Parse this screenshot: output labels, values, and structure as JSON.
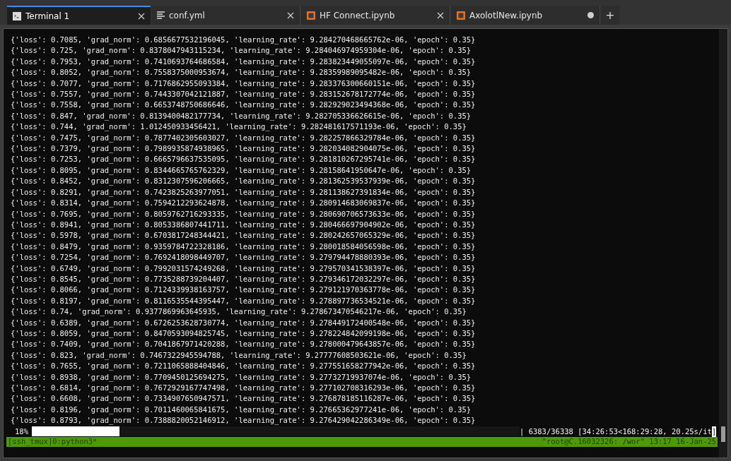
{
  "tabs": [
    {
      "label": "Terminal 1",
      "kind": "terminal",
      "selected": true,
      "modified": false
    },
    {
      "label": "conf.yml",
      "kind": "text",
      "selected": false,
      "modified": false
    },
    {
      "label": "HF Connect.ipynb",
      "kind": "notebook",
      "selected": false,
      "modified": false
    },
    {
      "label": "AxolotlNew.ipynb",
      "kind": "notebook",
      "selected": false,
      "modified": true
    }
  ],
  "new_tab": "+",
  "terminal": {
    "lines": [
      "{'loss': 0.7085, 'grad_norm': 0.6856677532196045, 'learning_rate': 9.284270468665762e-06, 'epoch': 0.35}",
      "{'loss': 0.725, 'grad_norm': 0.8378047943115234, 'learning_rate': 9.284046974959304e-06, 'epoch': 0.35}",
      "{'loss': 0.7953, 'grad_norm': 0.7410693764686584, 'learning_rate': 9.283823449055097e-06, 'epoch': 0.35}",
      "{'loss': 0.8052, 'grad_norm': 0.7558375000953674, 'learning_rate': 9.28359989095482e-06, 'epoch': 0.35}",
      "{'loss': 0.7077, 'grad_norm': 0.7176862955093384, 'learning_rate': 9.283376300660151e-06, 'epoch': 0.35}",
      "{'loss': 0.7557, 'grad_norm': 0.7443307042121887, 'learning_rate': 9.283152678172774e-06, 'epoch': 0.35}",
      "{'loss': 0.7558, 'grad_norm': 0.6653748750686646, 'learning_rate': 9.282929023494368e-06, 'epoch': 0.35}",
      "{'loss': 0.847, 'grad_norm': 0.8139400482177734, 'learning_rate': 9.282705336626615e-06, 'epoch': 0.35}",
      "{'loss': 0.744, 'grad_norm': 1.012450933456421, 'learning_rate': 9.282481617571193e-06, 'epoch': 0.35}",
      "{'loss': 0.7475, 'grad_norm': 0.7877402305603027, 'learning_rate': 9.282257866329784e-06, 'epoch': 0.35}",
      "{'loss': 0.7379, 'grad_norm': 0.7989935874938965, 'learning_rate': 9.282034082904075e-06, 'epoch': 0.35}",
      "{'loss': 0.7253, 'grad_norm': 0.6665796637535095, 'learning_rate': 9.281810267295741e-06, 'epoch': 0.35}",
      "{'loss': 0.8095, 'grad_norm': 0.8344665765762329, 'learning_rate': 9.28158641950647e-06, 'epoch': 0.35}",
      "{'loss': 0.8452, 'grad_norm': 0.8312307596206665, 'learning_rate': 9.281362539537939e-06, 'epoch': 0.35}",
      "{'loss': 0.8291, 'grad_norm': 0.7423825263977051, 'learning_rate': 9.281138627391834e-06, 'epoch': 0.35}",
      "{'loss': 0.8314, 'grad_norm': 0.7594212293624878, 'learning_rate': 9.280914683069837e-06, 'epoch': 0.35}",
      "{'loss': 0.7695, 'grad_norm': 0.8059762716293335, 'learning_rate': 9.280690706573633e-06, 'epoch': 0.35}",
      "{'loss': 0.8941, 'grad_norm': 0.8053386807441711, 'learning_rate': 9.280466697904902e-06, 'epoch': 0.35}",
      "{'loss': 0.5978, 'grad_norm': 0.6703817248344421, 'learning_rate': 9.280242657065329e-06, 'epoch': 0.35}",
      "{'loss': 0.8479, 'grad_norm': 0.9359784722328186, 'learning_rate': 9.280018584056598e-06, 'epoch': 0.35}",
      "{'loss': 0.7254, 'grad_norm': 0.7692418098449707, 'learning_rate': 9.279794478880393e-06, 'epoch': 0.35}",
      "{'loss': 0.6749, 'grad_norm': 0.7992031574249268, 'learning_rate': 9.279570341538397e-06, 'epoch': 0.35}",
      "{'loss': 0.8545, 'grad_norm': 0.7735288739204407, 'learning_rate': 9.279346172032297e-06, 'epoch': 0.35}",
      "{'loss': 0.8066, 'grad_norm': 0.7124339938163757, 'learning_rate': 9.279121970363778e-06, 'epoch': 0.35}",
      "{'loss': 0.8197, 'grad_norm': 0.8116535544395447, 'learning_rate': 9.278897736534521e-06, 'epoch': 0.35}",
      "{'loss': 0.74, 'grad_norm': 0.9377869963645935, 'learning_rate': 9.278673470546217e-06, 'epoch': 0.35}",
      "{'loss': 0.6389, 'grad_norm': 0.6726253628730774, 'learning_rate': 9.278449172400548e-06, 'epoch': 0.35}",
      "{'loss': 0.8059, 'grad_norm': 0.8470593094825745, 'learning_rate': 9.278224842099198e-06, 'epoch': 0.35}",
      "{'loss': 0.7409, 'grad_norm': 0.7041867971420288, 'learning_rate': 9.278000479643857e-06, 'epoch': 0.35}",
      "{'loss': 0.823, 'grad_norm': 0.7467322945594788, 'learning_rate': 9.27777608503621e-06, 'epoch': 0.35}",
      "{'loss': 0.7655, 'grad_norm': 0.7211065888404846, 'learning_rate': 9.277551658277942e-06, 'epoch': 0.35}",
      "{'loss': 0.8938, 'grad_norm': 0.7709450125694275, 'learning_rate': 9.27732719937074e-06, 'epoch': 0.35}",
      "{'loss': 0.6814, 'grad_norm': 0.7672929167747498, 'learning_rate': 9.277102708316293e-06, 'epoch': 0.35}",
      "{'loss': 0.6608, 'grad_norm': 0.7334907650947571, 'learning_rate': 9.276878185116287e-06, 'epoch': 0.35}",
      "{'loss': 0.8196, 'grad_norm': 0.7011460065841675, 'learning_rate': 9.27665362977241e-06, 'epoch': 0.35}",
      "{'loss': 0.8793, 'grad_norm': 0.7388820052146912, 'learning_rate': 9.276429042286349e-06, 'epoch': 0.35}"
    ],
    "progress": {
      "percent": "18%",
      "level": 0.18,
      "reading": "| 6383/36338 [34:26:53<168:29:28, 20.25s/it",
      "cursor_char": "]"
    },
    "status_bar": {
      "left": "[ssh_tmux]0:python3*",
      "right": "\"root@C.16032326: /wor\" 13:17 16-Jan-25"
    }
  }
}
